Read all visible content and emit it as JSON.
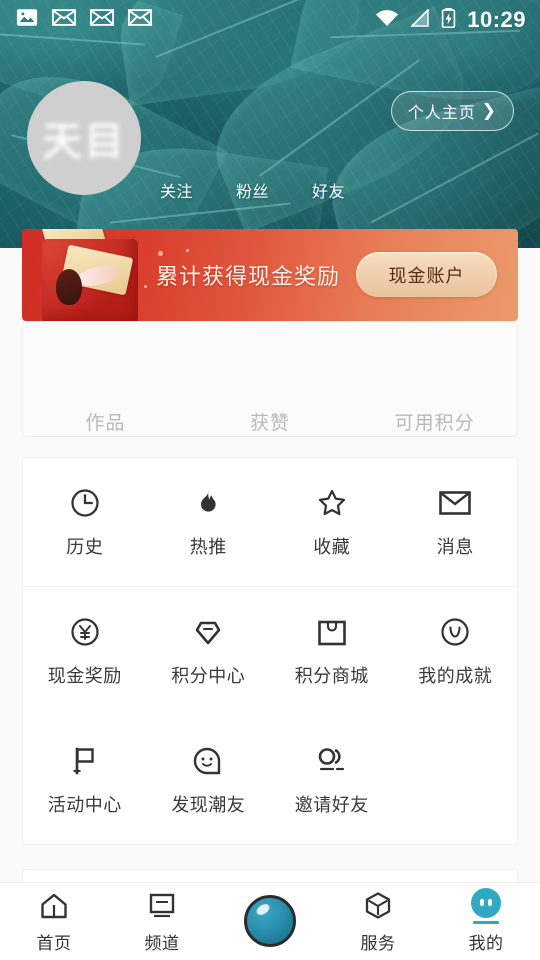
{
  "status_bar": {
    "time": "10:29",
    "left_icons": [
      "image-icon",
      "mail-icon",
      "mail-icon",
      "mail-icon"
    ],
    "right_icons": [
      "wifi-icon",
      "signal-off-icon",
      "battery-charging-icon"
    ]
  },
  "header": {
    "avatar_text": "天目",
    "home_button_label": "个人主页",
    "home_button_chevron": "❯",
    "links": [
      {
        "label": "关注"
      },
      {
        "label": "粉丝"
      },
      {
        "label": "好友"
      }
    ]
  },
  "banner": {
    "title": "累计获得现金奖励",
    "button_label": "现金账户",
    "colors": {
      "start": "#cf2d25",
      "end": "#eb9a6c",
      "button_bg": "#f0cfa8",
      "button_text": "#5a2b14"
    }
  },
  "stats": [
    {
      "value": "",
      "label": "作品"
    },
    {
      "value": "",
      "label": "获赞"
    },
    {
      "value": "",
      "label": "可用积分"
    }
  ],
  "menu_rows": [
    [
      {
        "label": "历史",
        "icon": "clock-icon"
      },
      {
        "label": "热推",
        "icon": "flame-icon"
      },
      {
        "label": "收藏",
        "icon": "star-icon"
      },
      {
        "label": "消息",
        "icon": "envelope-icon"
      }
    ],
    [
      {
        "label": "现金奖励",
        "icon": "yuan-circle-icon"
      },
      {
        "label": "积分中心",
        "icon": "diamond-icon"
      },
      {
        "label": "积分商城",
        "icon": "shopping-bag-icon"
      },
      {
        "label": "我的成就",
        "icon": "v-circle-icon"
      }
    ],
    [
      {
        "label": "活动中心",
        "icon": "flag-icon"
      },
      {
        "label": "发现潮友",
        "icon": "smiley-chat-icon"
      },
      {
        "label": "邀请好友",
        "icon": "friends-icon"
      }
    ]
  ],
  "tabbar": {
    "active_color": "#2fa8c4",
    "items": [
      {
        "label": "首页",
        "icon": "home-icon",
        "active": false
      },
      {
        "label": "频道",
        "icon": "tv-icon",
        "active": false
      },
      {
        "label": "",
        "icon": "orb-button-icon",
        "active": false
      },
      {
        "label": "服务",
        "icon": "cube-icon",
        "active": false
      },
      {
        "label": "我的",
        "icon": "profile-face-icon",
        "active": true
      }
    ]
  }
}
